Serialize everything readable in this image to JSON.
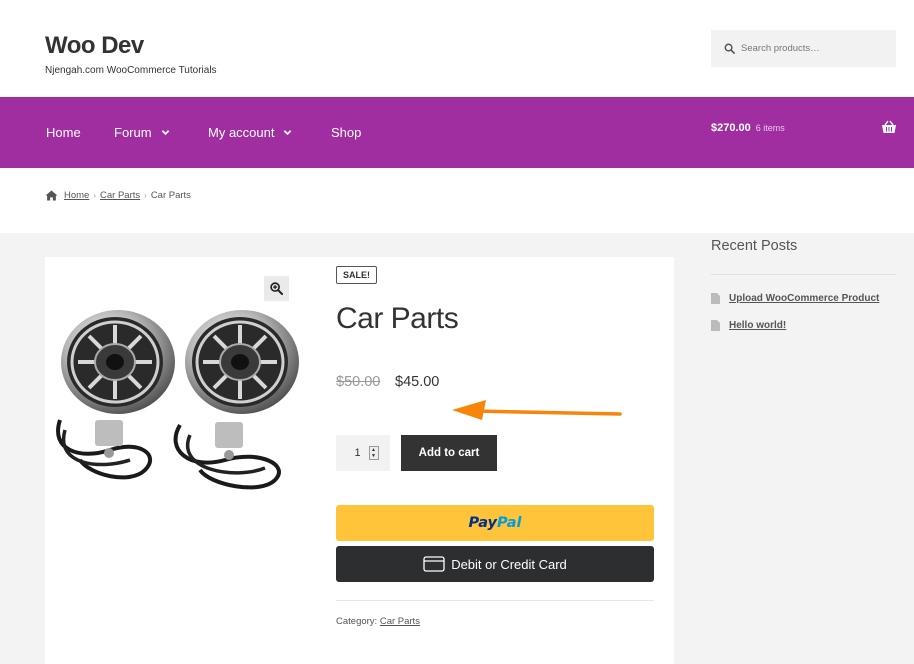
{
  "header": {
    "site_title": "Woo Dev",
    "site_description": "Njengah.com WooCommerce Tutorials",
    "search_placeholder": "Search products…"
  },
  "nav": {
    "items": [
      {
        "label": "Home",
        "has_dropdown": false
      },
      {
        "label": "Forum",
        "has_dropdown": true
      },
      {
        "label": "My account",
        "has_dropdown": true
      },
      {
        "label": "Shop",
        "has_dropdown": false
      }
    ],
    "cart_total": "$270.00",
    "cart_count": "6 items",
    "cart_icon": "basket-icon"
  },
  "breadcrumb": {
    "home": "Home",
    "category": "Car Parts",
    "current": "Car Parts",
    "separator": "›"
  },
  "product": {
    "sale_badge": "SALE!",
    "title": "Car Parts",
    "price_old": "$50.00",
    "price_new": "$45.00",
    "quantity": "1",
    "add_to_cart_label": "Add to cart",
    "paypal_pay": "Pay",
    "paypal_pal": "Pal",
    "card_button_label": "Debit or Credit Card",
    "category_label": "Category:",
    "category_link": "Car Parts"
  },
  "sidebar": {
    "title": "Recent Posts",
    "posts": [
      {
        "label": "Upload WooCommerce Product"
      },
      {
        "label": "Hello world!"
      }
    ]
  },
  "colors": {
    "nav_bg": "#a02ea1",
    "paypal_yellow": "#ffc439",
    "arrow_orange": "#f7850a",
    "dark_button": "#333333"
  }
}
